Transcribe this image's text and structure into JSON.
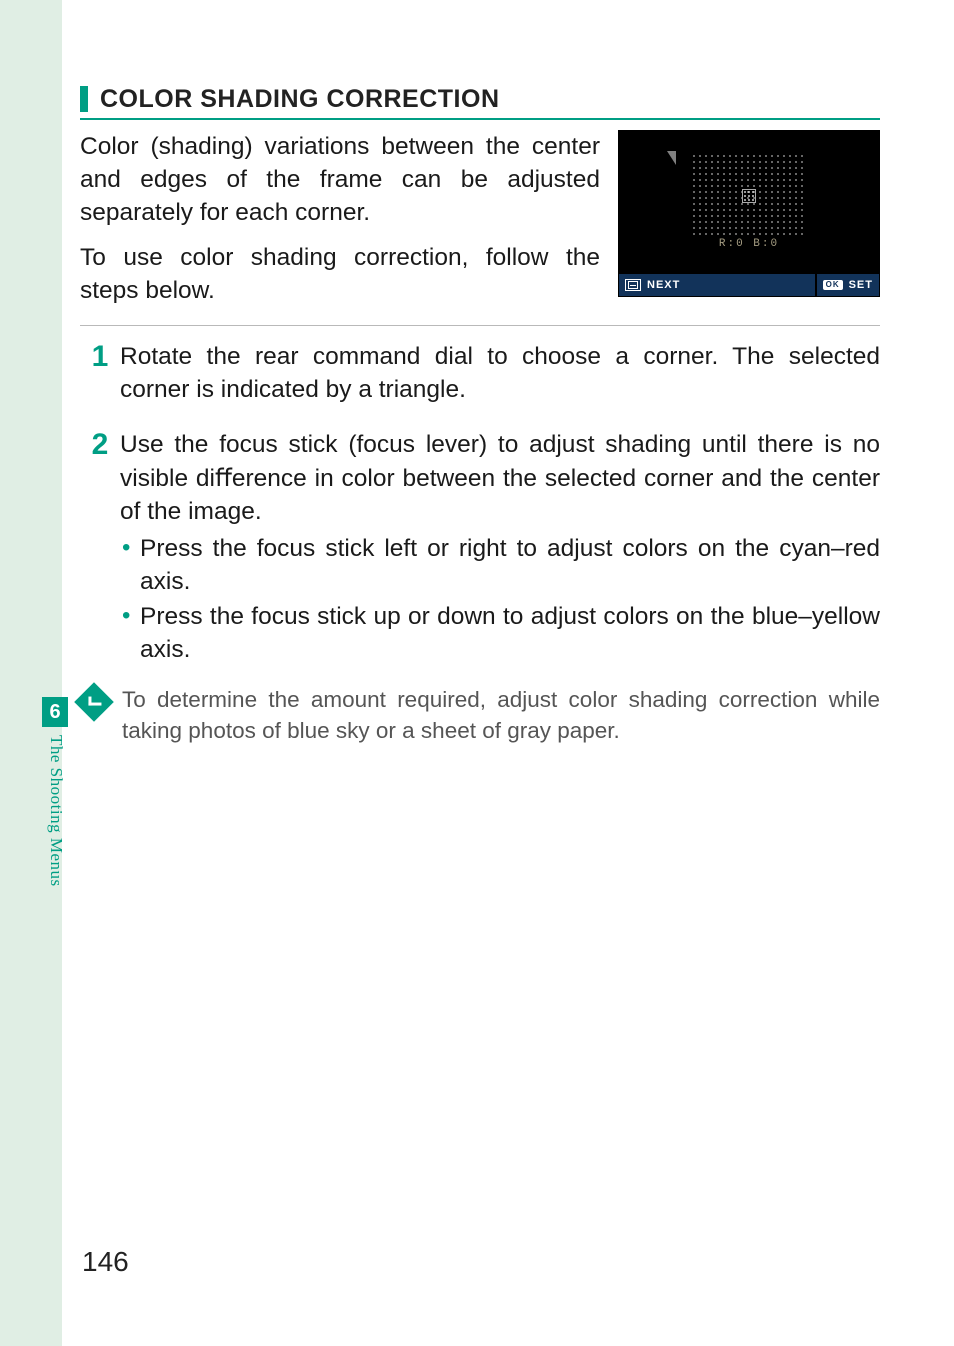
{
  "section": {
    "title": "COLOR SHADING CORRECTION",
    "intro": [
      "Color (shading) variations between the center and edges of the frame can be ad­justed separately for each corner.",
      "To use color shading correction, follow the steps below."
    ]
  },
  "lcd": {
    "rb_label": "R:0  B:0",
    "next_label": "NEXT",
    "ok_badge": "OK",
    "set_label": "SET"
  },
  "steps": [
    {
      "num": "1",
      "text": "Rotate the rear command dial to choose a corner. The select­ed corner is indicated by a triangle.",
      "bullets": []
    },
    {
      "num": "2",
      "text": "Use the focus stick (focus lever) to adjust shading until there is no visible diﬀerence in color between the selected corner and the center of the image.",
      "bullets": [
        "Press the focus stick left or right to adjust colors on the cyan–red axis.",
        "Press the focus stick up or down to adjust colors on the blue–yellow axis."
      ]
    }
  ],
  "note": "To determine the amount required, adjust color shading correction while taking photos of blue sky or a sheet of gray paper.",
  "chapter": {
    "num": "6",
    "label": "The Shooting Menus"
  },
  "page_number": "146"
}
